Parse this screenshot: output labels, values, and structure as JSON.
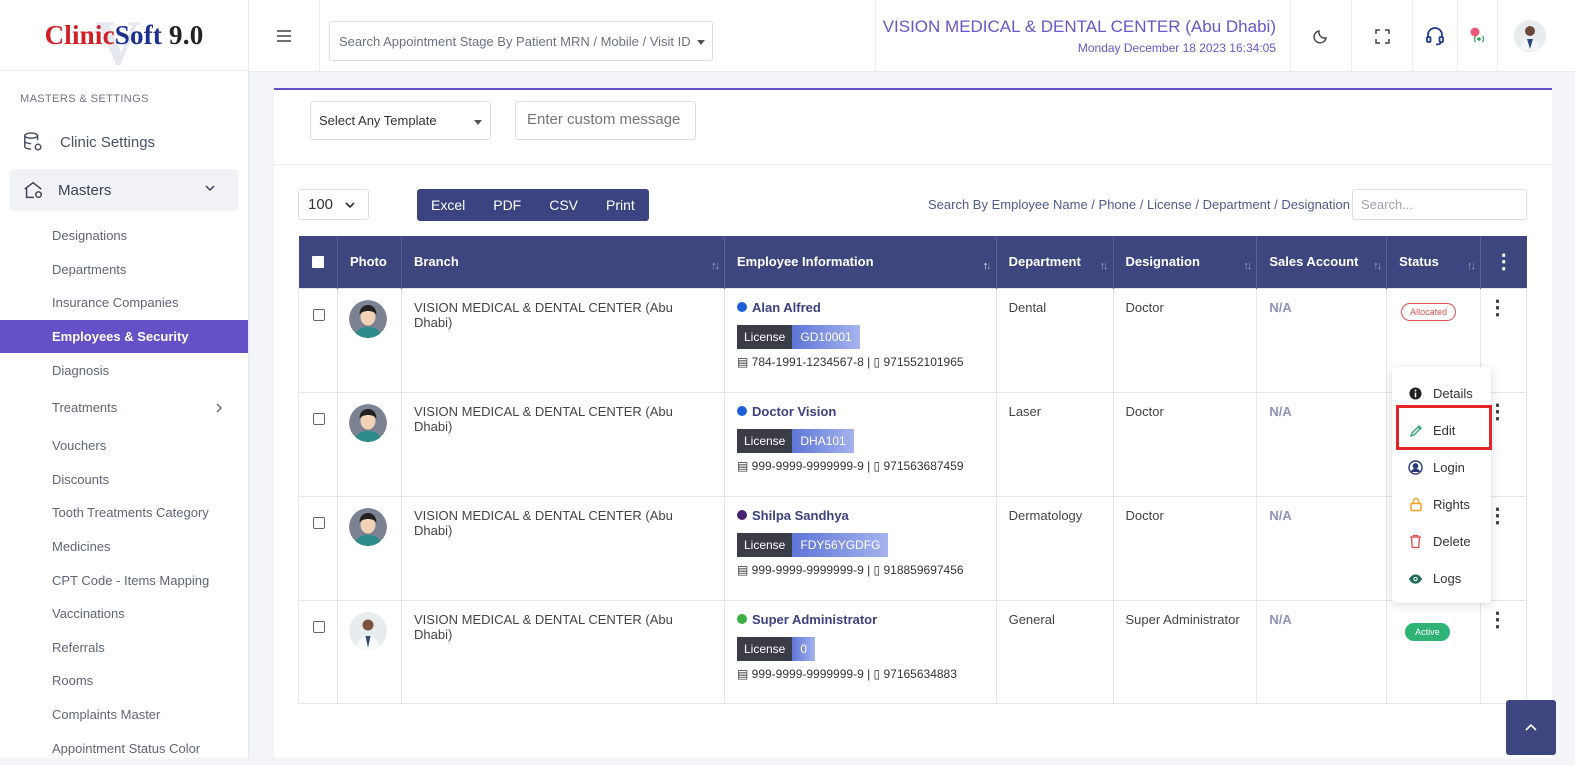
{
  "app": {
    "logo_part1": "Clinic",
    "logo_part2": "Soft",
    "logo_part3": " 9.0",
    "logo_watermark": "V"
  },
  "header": {
    "search_placeholder": "Search Appointment Stage By Patient MRN / Mobile / Visit ID",
    "clinic_name": "VISION MEDICAL & DENTAL CENTER (Abu Dhabi)",
    "datetime": "Monday December 18 2023 16:34:05"
  },
  "sidebar": {
    "section_label": "MASTERS & SETTINGS",
    "clinic_settings": "Clinic Settings",
    "masters": "Masters",
    "items": [
      {
        "label": "Designations"
      },
      {
        "label": "Departments"
      },
      {
        "label": "Insurance Companies"
      },
      {
        "label": "Employees & Security"
      },
      {
        "label": "Diagnosis"
      },
      {
        "label": "Treatments"
      },
      {
        "label": "Vouchers"
      },
      {
        "label": "Discounts"
      },
      {
        "label": "Tooth Treatments Category"
      },
      {
        "label": "Medicines"
      },
      {
        "label": "CPT Code - Items Mapping"
      },
      {
        "label": "Vaccinations"
      },
      {
        "label": "Referrals"
      },
      {
        "label": "Rooms"
      },
      {
        "label": "Complaints Master"
      },
      {
        "label": "Appointment Status Color"
      }
    ]
  },
  "template": {
    "select_value": "Select Any Template",
    "message_placeholder": "Enter custom message"
  },
  "table_controls": {
    "page_length": "100",
    "export_buttons": [
      "Excel",
      "PDF",
      "CSV",
      "Print"
    ],
    "search_label": "Search By Employee Name / Phone / License / Department / Designation",
    "search_placeholder": "Search..."
  },
  "table": {
    "columns": [
      "Photo",
      "Branch",
      "Employee Information",
      "Department",
      "Designation",
      "Sales Account",
      "Status"
    ],
    "rows": [
      {
        "branch": "VISION MEDICAL & DENTAL CENTER (Abu Dhabi)",
        "name": "Alan Alfred",
        "dot_color": "#1a5fd6",
        "license_label": "License",
        "license": "GD10001",
        "contact": "784-1991-1234567-8 | ▯ 971552101965",
        "department": "Dental",
        "designation": "Doctor",
        "sales": "N/A",
        "status": "Allocated"
      },
      {
        "branch": "VISION MEDICAL & DENTAL CENTER (Abu Dhabi)",
        "name": "Doctor Vision",
        "dot_color": "#1a5fd6",
        "license_label": "License",
        "license": "DHA101",
        "contact": "999-9999-9999999-9 | ▯ 971563687459",
        "department": "Laser",
        "designation": "Doctor",
        "sales": "N/A",
        "status": ""
      },
      {
        "branch": "VISION MEDICAL & DENTAL CENTER (Abu Dhabi)",
        "name": "Shilpa Sandhya",
        "dot_color": "#4a2370",
        "license_label": "License",
        "license": "FDY56YGDFG",
        "contact": "999-9999-9999999-9 | ▯ 918859697456",
        "department": "Dermatology",
        "designation": "Doctor",
        "sales": "N/A",
        "status": ""
      },
      {
        "branch": "VISION MEDICAL & DENTAL CENTER (Abu Dhabi)",
        "name": "Super Administrator",
        "dot_color": "#3cb043",
        "license_label": "License",
        "license": "0",
        "contact": "999-9999-9999999-9 | ▯ 97165634883",
        "department": "General",
        "designation": "Super Administrator",
        "sales": "N/A",
        "status": "Active"
      }
    ]
  },
  "action_menu": {
    "items": [
      {
        "label": "Details",
        "icon": "info-icon"
      },
      {
        "label": "Edit",
        "icon": "pencil-icon"
      },
      {
        "label": "Login",
        "icon": "user-circle-icon"
      },
      {
        "label": "Rights",
        "icon": "lock-icon"
      },
      {
        "label": "Delete",
        "icon": "trash-icon"
      },
      {
        "label": "Logs",
        "icon": "eye-icon"
      }
    ]
  },
  "colors": {
    "accent": "#6650c7",
    "table_header": "#3e4680",
    "highlight": "#e52427"
  }
}
